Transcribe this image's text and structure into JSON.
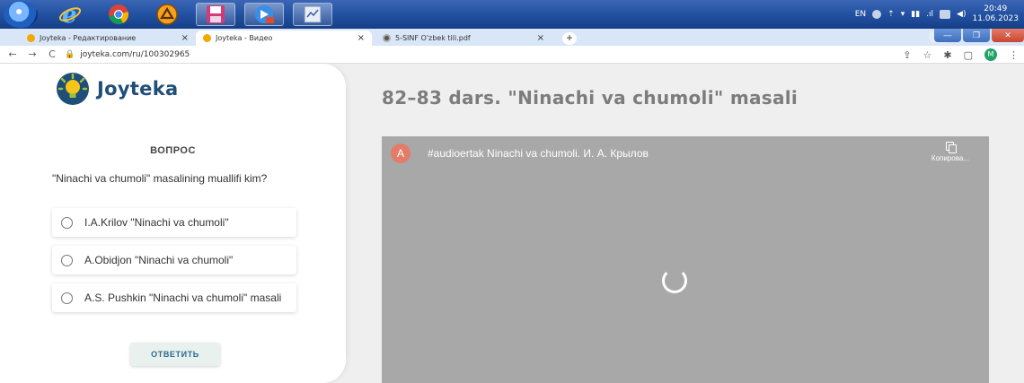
{
  "taskbar": {
    "apps": [
      "internet-explorer",
      "chrome",
      "avast",
      "floppy-save",
      "media",
      "notes"
    ],
    "tray": {
      "lang": "EN",
      "time": "20:49",
      "date": "11.06.2023"
    }
  },
  "browser": {
    "tabs": [
      {
        "label": "Joyteka - Редактирование",
        "active": false
      },
      {
        "label": "Joyteka - Видео",
        "active": true
      },
      {
        "label": "5-SINF O'zbek tili.pdf",
        "active": false
      }
    ],
    "url": "joyteka.com/ru/100302965",
    "profile_initial": "M"
  },
  "brand": {
    "name": "Joyteka"
  },
  "quiz": {
    "heading": "ВОПРОС",
    "question": "\"Ninachi va chumoli\" masalining muallifi kim?",
    "options": [
      "I.A.Krilov \"Ninachi va chumoli\"",
      "A.Obidjon \"Ninachi va chumoli\"",
      "A.S. Pushkin \"Ninachi va chumoli\" masali"
    ],
    "submit_label": "ОТВЕТИТЬ"
  },
  "lesson": {
    "title": "82–83 dars. \"Ninachi va chumoli\" masali",
    "video": {
      "channel_initial": "A",
      "title": "#audioertak Ninachi va chumoli. И. А. Крылов",
      "copy_label": "Копирова..."
    }
  },
  "colors": {
    "brand_blue": "#1f4e79",
    "video_bg": "#a8a8a8",
    "taskbar": "#214f9f"
  }
}
